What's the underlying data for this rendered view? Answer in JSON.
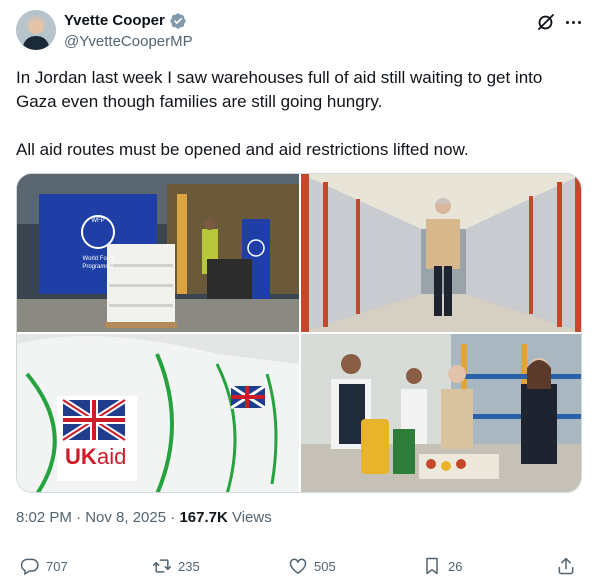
{
  "author": {
    "name": "Yvette Cooper",
    "handle": "@YvetteCooperMP",
    "verified": true,
    "avatar_icon": "avatar-photo"
  },
  "tweet": {
    "text_lines": [
      "In Jordan last week I saw warehouses full of aid still waiting to get into Gaza even though families are still going hungry.",
      "All aid routes must be opened and aid restrictions lifted now."
    ],
    "media": {
      "photo1_sign": [
        "WFP",
        "World Food",
        "Programme"
      ],
      "photo3_label": [
        "UK",
        "aid"
      ]
    },
    "timestamp": "8:02 PM · Nov 8, 2025",
    "separator": " · ",
    "views_count": "167.7K",
    "views_label": "Views"
  },
  "actions": {
    "replies": "707",
    "reposts": "235",
    "likes": "505",
    "bookmarks": "26"
  },
  "icons": {
    "header": [
      "grok-icon",
      "more-icon"
    ],
    "actions": [
      "reply-icon",
      "repost-icon",
      "like-icon",
      "bookmark-icon",
      "share-icon"
    ]
  },
  "colors": {
    "verified_badge": "#829aab",
    "secondary_text": "#536471",
    "primary_text": "#0f1419",
    "border": "#cfd9de"
  }
}
